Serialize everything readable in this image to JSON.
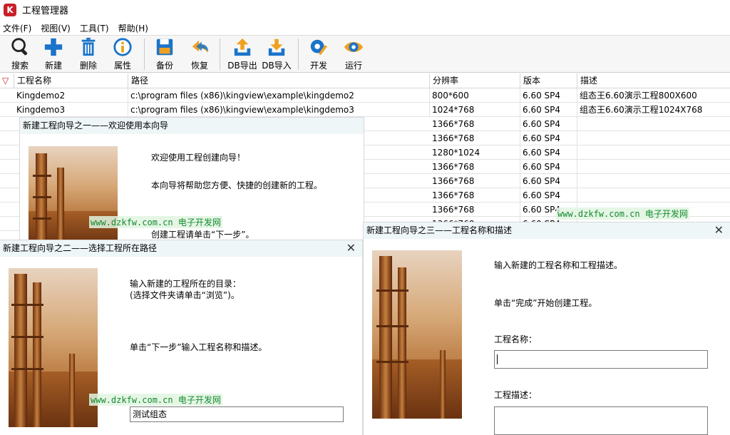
{
  "window": {
    "title": "工程管理器",
    "app_icon_letter": "K"
  },
  "menu": [
    "文件(F)",
    "视图(V)",
    "工具(T)",
    "帮助(H)"
  ],
  "toolbar": {
    "search": "搜索",
    "new": "新建",
    "delete": "删除",
    "properties": "属性",
    "backup": "备份",
    "restore": "恢复",
    "db_export": "DB导出",
    "db_import": "DB导入",
    "develop": "开发",
    "run": "运行"
  },
  "table": {
    "headers": {
      "name": "工程名称",
      "path": "路径",
      "resolution": "分辨率",
      "version": "版本",
      "description": "描述"
    },
    "rows": [
      {
        "name": "Kingdemo2",
        "path": "c:\\program files (x86)\\kingview\\example\\kingdemo2",
        "resolution": "800*600",
        "version": "6.60 SP4",
        "description": "组态王6.60演示工程800X600"
      },
      {
        "name": "Kingdemo3",
        "path": "c:\\program files (x86)\\kingview\\example\\kingdemo3",
        "resolution": "1024*768",
        "version": "6.60 SP4",
        "description": "组态王6.60演示工程1024X768"
      },
      {
        "name": "",
        "path": "",
        "resolution": "1366*768",
        "version": "6.60 SP4",
        "description": ""
      },
      {
        "name": "",
        "path": "",
        "resolution": "1366*768",
        "version": "6.60 SP4",
        "description": ""
      },
      {
        "name": "",
        "path": "",
        "resolution": "1280*1024",
        "version": "6.60 SP4",
        "description": ""
      },
      {
        "name": "",
        "path": "",
        "resolution": "1366*768",
        "version": "6.60 SP4",
        "description": ""
      },
      {
        "name": "",
        "path": "",
        "resolution": "1366*768",
        "version": "6.60 SP4",
        "description": ""
      },
      {
        "name": "",
        "path": "",
        "resolution": "1366*768",
        "version": "6.60 SP4",
        "description": ""
      },
      {
        "name": "",
        "path": "",
        "resolution": "1366*768",
        "version": "6.60 SP4",
        "description": ""
      },
      {
        "name": "",
        "path": "",
        "resolution": "1366*768",
        "version": "6.60 SP4",
        "description": ""
      }
    ]
  },
  "wizard1": {
    "title": "新建工程向导之一——欢迎使用本向导",
    "line1": "欢迎使用工程创建向导！",
    "line2": "本向导将帮助您方便、快捷的创建新的工程。",
    "line3": "创建工程请单击“下一步”。"
  },
  "wizard2": {
    "title": "新建工程向导之二——选择工程所在路径",
    "line1": "输入新建的工程所在的目录：",
    "line2": "(选择文件夹请单击“浏览”)。",
    "line3": "单击“下一步”输入工程名称和描述。",
    "path_value": "测试组态"
  },
  "wizard3": {
    "title": "新建工程向导之三——工程名称和描述",
    "line1": "输入新建的工程名称和工程描述。",
    "line2": "单击“完成”开始创建工程。",
    "name_label": "工程名称：",
    "desc_label": "工程描述："
  },
  "watermark": {
    "url": "www.dzkfw.com.cn",
    "text": "电子开发网"
  },
  "colors": {
    "watermark_green": "#138a2e",
    "dialog_title_bg": "#eef6f8",
    "accent_blue": "#1a74c9"
  }
}
